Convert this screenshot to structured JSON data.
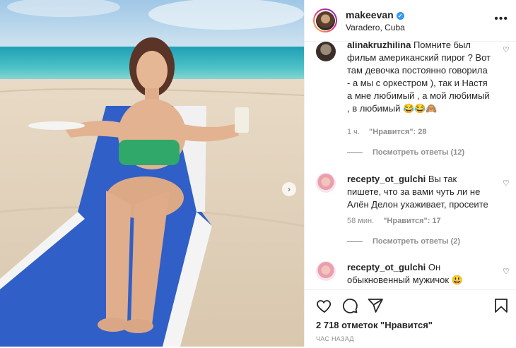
{
  "post": {
    "username": "makeevan",
    "location": "Varadero, Cuba",
    "more_label": "•••",
    "likes_text": "2 718 отметок \"Нравится\"",
    "time_ago": "ЧАС НАЗАД"
  },
  "comments": [
    {
      "username": "alinakruzhilina",
      "text": "Помните был фильм американский пирог ? Вот там девочка постоянно говорила - а мы с оркестром ), так и Настя а мне любимый , а мой любимый , в любимый 😂😂🙈",
      "time": "1 ч.",
      "likes": "\"Нравится\": 28",
      "replies": "Посмотреть ответы (12)"
    },
    {
      "username": "recepty_ot_gulchi",
      "text": "Вы так пишете, что за вами чуть ли не Алён Делон ухаживает, просеите",
      "time": "58 мин.",
      "likes": "\"Нравится\": 17",
      "replies": "Посмотреть ответы (2)"
    },
    {
      "username": "recepty_ot_gulchi",
      "text": "Он обыкновенный мужичок 😃"
    }
  ],
  "icons": {
    "like": "heart-icon",
    "comment": "comment-icon",
    "share": "paper-plane-icon",
    "save": "bookmark-icon",
    "carousel_next": "chevron-right-icon"
  },
  "colors": {
    "verified": "#3897f0",
    "secondary_text": "#8e8e8e",
    "border": "#efefef"
  }
}
